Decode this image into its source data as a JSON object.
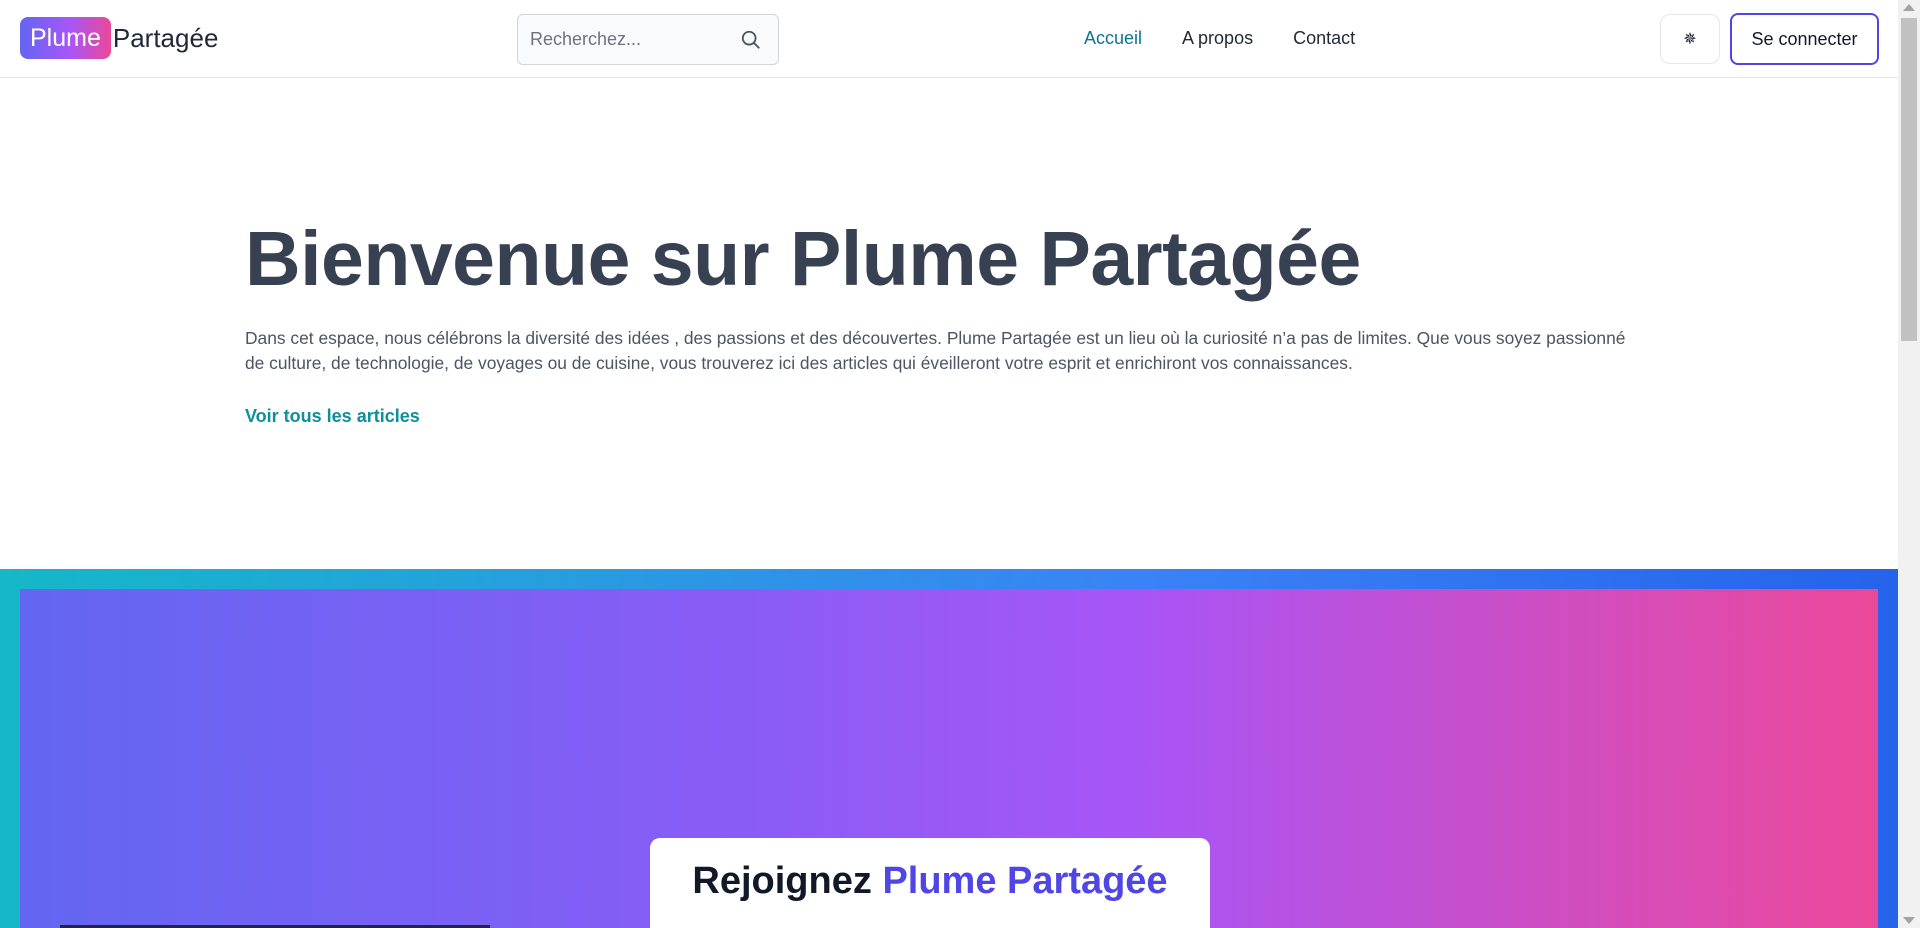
{
  "header": {
    "logo": {
      "badge": "Plume",
      "text": "Partagée"
    },
    "search": {
      "placeholder": "Recherchez...",
      "value": ""
    },
    "nav": [
      {
        "label": "Accueil",
        "active": true
      },
      {
        "label": "A propos",
        "active": false
      },
      {
        "label": "Contact",
        "active": false
      }
    ],
    "theme_toggle_icon": "✵",
    "login_label": "Se connecter"
  },
  "hero": {
    "title": "Bienvenue sur Plume Partagée",
    "text": "Dans cet espace, nous célébrons la diversité des idées , des passions et des découvertes. Plume Partagée est un lieu où la curiosité n’a pas de limites. Que vous soyez passionné de culture, de technologie, de voyages ou de cuisine, vous trouverez ici des articles qui éveilleront votre esprit et enrichiront vos connaissances.",
    "link": "Voir tous les articles"
  },
  "join": {
    "title_prefix": "Rejoignez",
    "title_accent": "Plume Partagée"
  },
  "colors": {
    "accent": "#4f46e5",
    "nav_active": "#0e7490",
    "link": "#0e8f9e"
  }
}
